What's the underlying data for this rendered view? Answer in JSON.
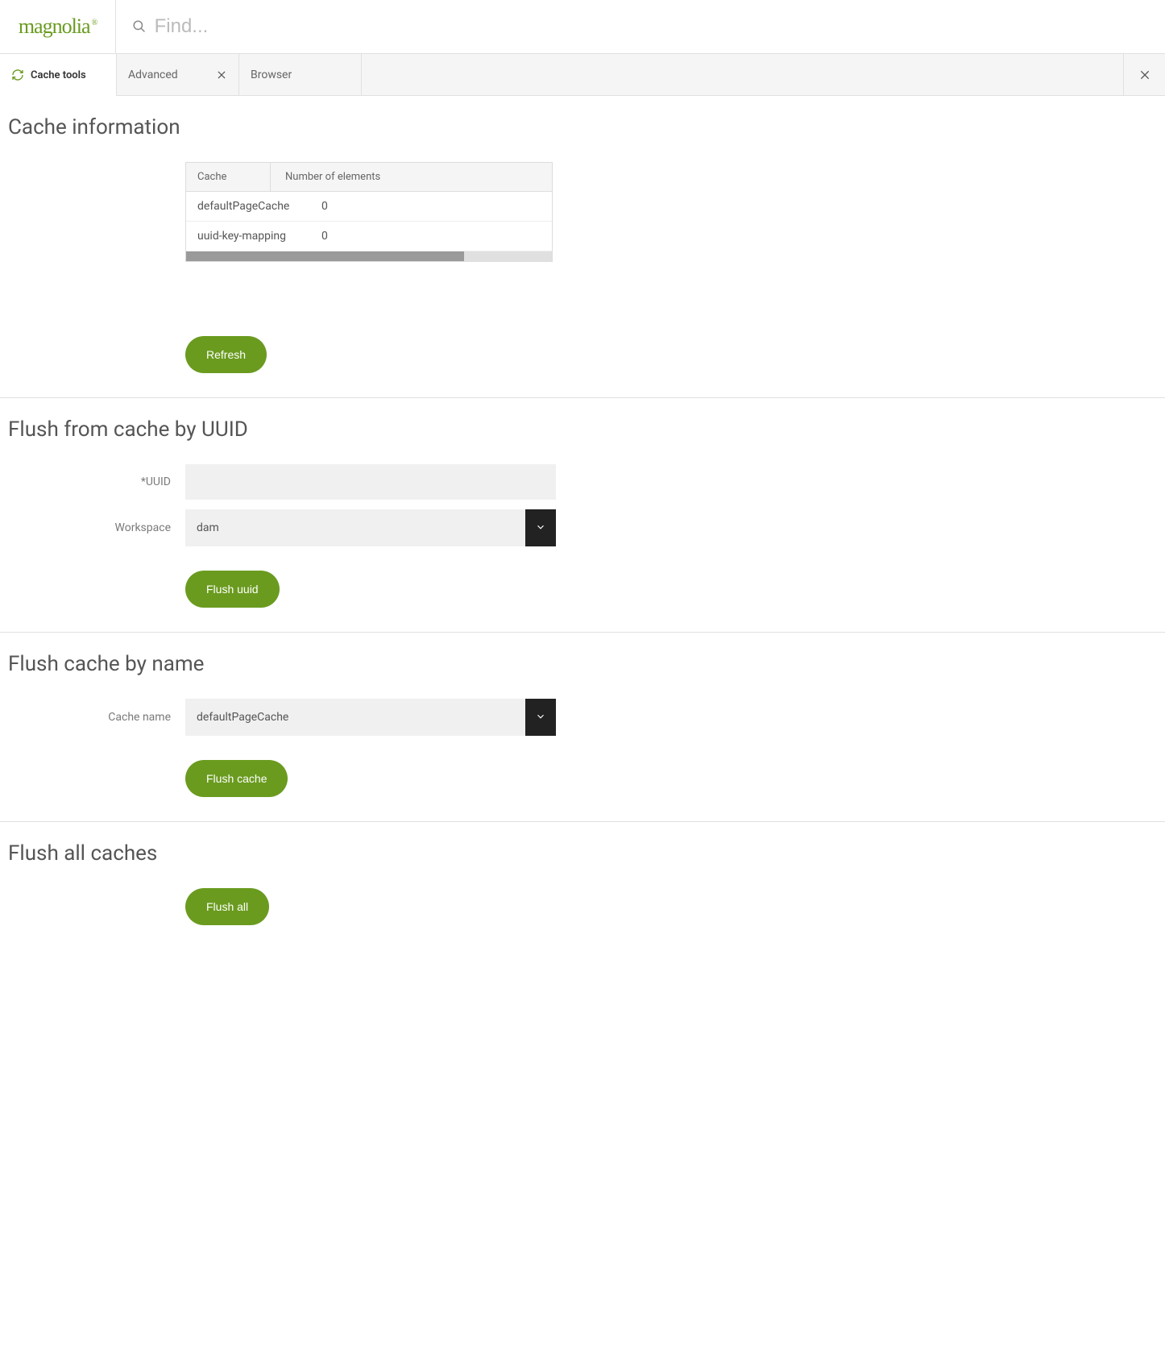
{
  "header": {
    "logo": "magnolia",
    "search_placeholder": "Find..."
  },
  "tabs": {
    "main": "Cache tools",
    "sub": [
      {
        "label": "Advanced",
        "closable": true
      },
      {
        "label": "Browser",
        "closable": false
      }
    ]
  },
  "sections": {
    "cache_info": {
      "title": "Cache information",
      "table": {
        "headers": [
          "Cache",
          "Number of elements"
        ],
        "rows": [
          {
            "name": "defaultPageCache",
            "count": "0"
          },
          {
            "name": "uuid-key-mapping",
            "count": "0"
          }
        ]
      },
      "refresh_label": "Refresh"
    },
    "flush_uuid": {
      "title": "Flush from cache by UUID",
      "uuid_label": "*UUID",
      "uuid_value": "",
      "workspace_label": "Workspace",
      "workspace_value": "dam",
      "button_label": "Flush uuid"
    },
    "flush_name": {
      "title": "Flush cache by name",
      "cache_name_label": "Cache name",
      "cache_name_value": "defaultPageCache",
      "button_label": "Flush cache"
    },
    "flush_all": {
      "title": "Flush all caches",
      "button_label": "Flush all"
    }
  }
}
